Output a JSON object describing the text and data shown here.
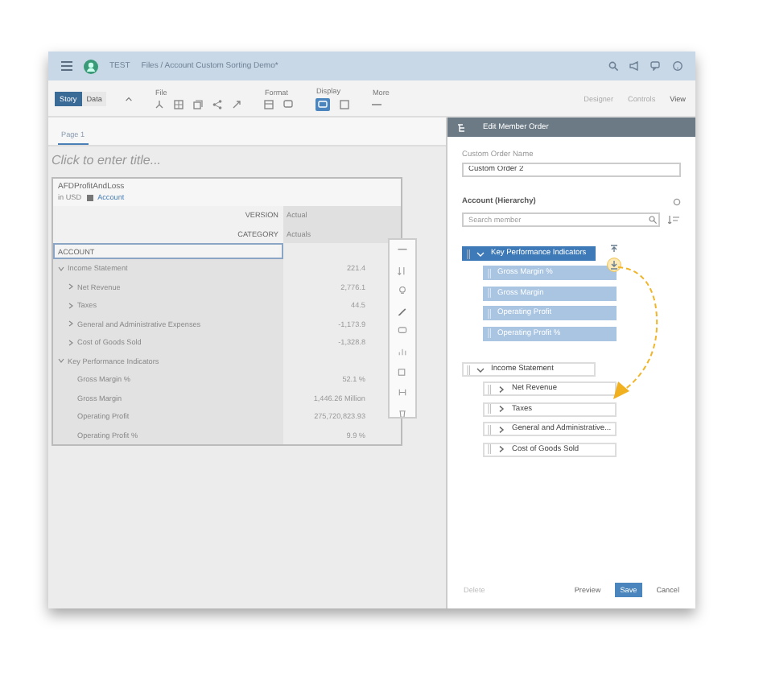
{
  "window": {
    "app_title": "TEST",
    "breadcrumb": "Files / Account Custom Sorting Demo*"
  },
  "toolbar": {
    "tabs": [
      {
        "label": "Story",
        "selected": true
      },
      {
        "label": "Data",
        "selected": false
      }
    ],
    "groups": [
      {
        "label": "File",
        "kind": "file"
      },
      {
        "label": "Format",
        "kind": "format"
      },
      {
        "label": "Display",
        "kind": "display"
      },
      {
        "label": "More",
        "kind": "more"
      }
    ],
    "modes": [
      {
        "label": "Designer",
        "selected": false
      },
      {
        "label": "Controls",
        "selected": false
      },
      {
        "label": "View",
        "selected": true
      }
    ]
  },
  "page_tabs": [
    {
      "label": "Page 1",
      "selected": true
    }
  ],
  "canvas": {
    "title_placeholder": "Click to enter title..."
  },
  "table": {
    "title": "AFDProfitAndLoss",
    "subtitle": "in USD",
    "filter_chip": "Account",
    "header_rows": [
      {
        "label": "VERSION",
        "value": "Actual"
      },
      {
        "label": "CATEGORY",
        "value": "Actuals"
      }
    ],
    "column_heading": "ACCOUNT",
    "rows": [
      {
        "label": "Income Statement",
        "kind": "node",
        "expanded": true,
        "value": "221.4",
        "children": [
          {
            "label": "Net Revenue",
            "kind": "node",
            "expanded": false,
            "value": "2,776.1"
          },
          {
            "label": "Taxes",
            "kind": "node",
            "expanded": false,
            "value": "44.5"
          },
          {
            "label": "General and Administrative Expenses",
            "kind": "node",
            "expanded": false,
            "value": "-1,173.9"
          },
          {
            "label": "Cost of Goods Sold",
            "kind": "node",
            "expanded": false,
            "value": "-1,328.8"
          }
        ]
      },
      {
        "label": "Key Performance Indicators",
        "kind": "node",
        "expanded": true,
        "value": "",
        "children": [
          {
            "label": "Gross Margin %",
            "kind": "leaf",
            "value": "52.1 %"
          },
          {
            "label": "Gross Margin",
            "kind": "leaf",
            "value": "1,446.26 Million"
          },
          {
            "label": "Operating Profit",
            "kind": "leaf",
            "value": "275,720,823.93"
          },
          {
            "label": "Operating Profit %",
            "kind": "leaf",
            "value": "9.9 %"
          }
        ]
      }
    ]
  },
  "panel": {
    "title": "Edit Member Order",
    "name_label": "Custom Order Name",
    "name_value": "Custom Order 2",
    "hierarchy_label": "Account (Hierarchy)",
    "search_placeholder": "Search member",
    "tree": [
      {
        "label": "Key Performance Indicators",
        "kind": "node",
        "expanded": true,
        "selected": true,
        "children": [
          {
            "label": "Gross Margin %",
            "kind": "leaf",
            "selected": true
          },
          {
            "label": "Gross Margin",
            "kind": "leaf",
            "selected": true
          },
          {
            "label": "Operating Profit",
            "kind": "leaf",
            "selected": true
          },
          {
            "label": "Operating Profit %",
            "kind": "leaf",
            "selected": true
          }
        ]
      },
      {
        "label": "Income Statement",
        "kind": "node",
        "expanded": true,
        "selected": false,
        "children": [
          {
            "label": "Net Revenue",
            "kind": "node",
            "expanded": false,
            "selected": false
          },
          {
            "label": "Taxes",
            "kind": "node",
            "expanded": false,
            "selected": false
          },
          {
            "label": "General and Administrative...",
            "kind": "node",
            "expanded": false,
            "selected": false
          },
          {
            "label": "Cost of Goods Sold",
            "kind": "node",
            "expanded": false,
            "selected": false
          }
        ]
      }
    ],
    "buttons": [
      {
        "label": "Delete",
        "kind": "plain",
        "disabled": true
      },
      {
        "label": "Preview",
        "kind": "plain",
        "disabled": false
      },
      {
        "label": "Save",
        "kind": "primary",
        "disabled": false
      },
      {
        "label": "Cancel",
        "kind": "plain",
        "disabled": false
      }
    ]
  }
}
